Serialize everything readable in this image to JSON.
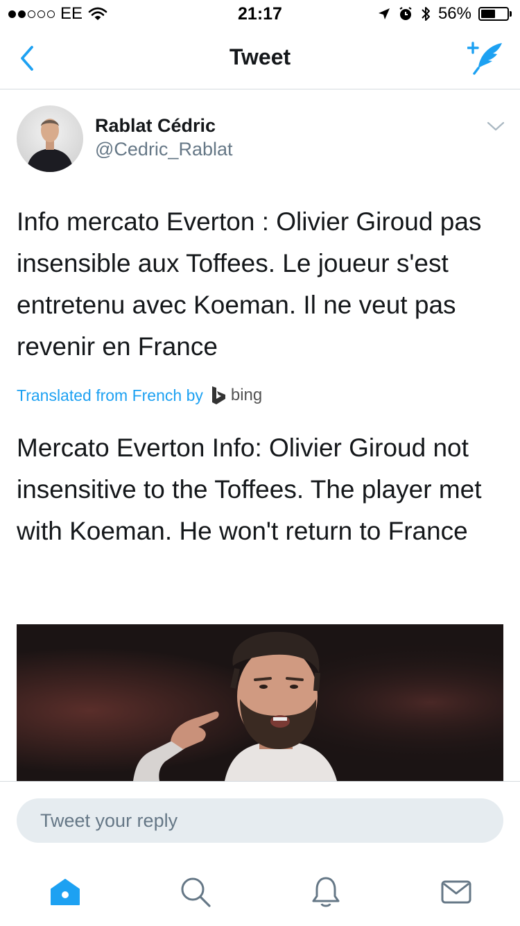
{
  "status_bar": {
    "signal_bars_filled": 2,
    "signal_bars_total": 5,
    "carrier": "EE",
    "time": "21:17",
    "battery_percent": "56%",
    "battery_level": 0.56
  },
  "nav": {
    "title": "Tweet",
    "icons": [
      "back-chevron-icon",
      "compose-tweet-icon"
    ]
  },
  "tweet": {
    "author_name": "Rablat Cédric",
    "author_handle": "@Cedric_Rablat",
    "text": "Info mercato Everton : Olivier Giroud pas insensible aux Toffees. Le joueur s'est entretenu avec Koeman. Il ne veut pas revenir en France",
    "translation_label": "Translated from French by",
    "translation_provider": "bing",
    "translated_text": "Mercato Everton Info: Olivier Giroud not insensitive to the Toffees. The player met with Koeman. He won't return to France"
  },
  "reply": {
    "placeholder": "Tweet your reply"
  },
  "tabbar": {
    "items": [
      "home-icon",
      "search-icon",
      "notifications-icon",
      "messages-icon"
    ],
    "active": "home-icon"
  },
  "colors": {
    "accent": "#1da1f2",
    "text": "#14171a",
    "secondary": "#657786",
    "divider": "#d6dbdf",
    "reply_bg": "#e6ecf0"
  }
}
